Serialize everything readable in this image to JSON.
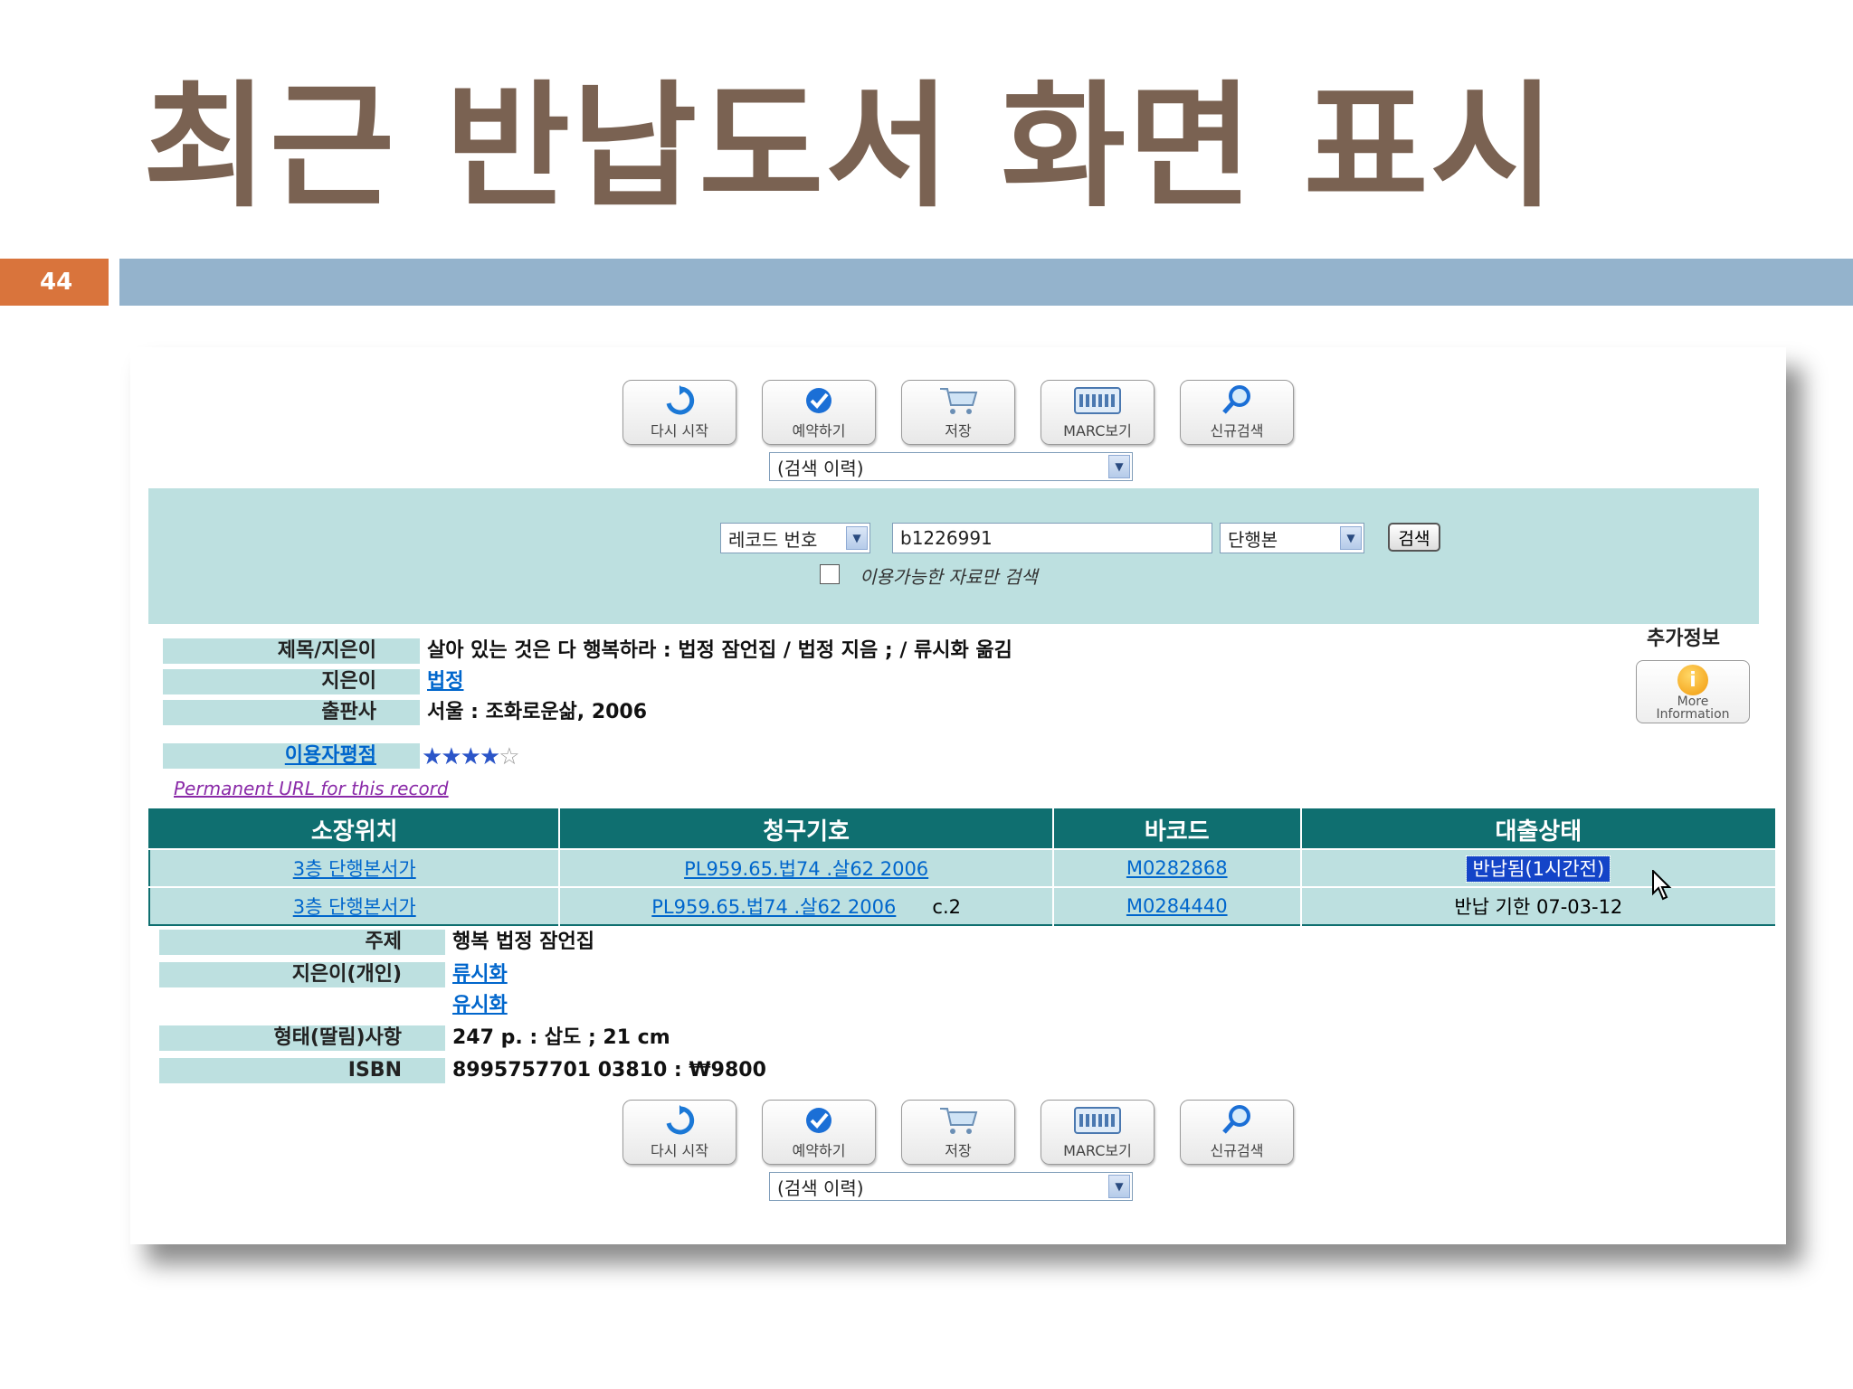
{
  "slide": {
    "title": "최근 반납도서 화면 표시",
    "number": "44"
  },
  "toolbar": {
    "buttons": [
      {
        "label": "다시 시작",
        "icon": "refresh-icon"
      },
      {
        "label": "예약하기",
        "icon": "checkmark-icon"
      },
      {
        "label": "저장",
        "icon": "cart-icon"
      },
      {
        "label": "MARC보기",
        "icon": "marc-grid-icon"
      },
      {
        "label": "신규검색",
        "icon": "magnifier-icon"
      }
    ],
    "history_select": "(검색 이력)"
  },
  "search": {
    "field_select": "레코드 번호",
    "query_value": "b1226991",
    "type_select": "단행본",
    "submit_label": "검색",
    "available_only_label": "이용가능한 자료만 검색"
  },
  "record": {
    "title_label": "제목/지은이",
    "title_value": "살아 있는 것은 다 행복하라 : 법정 잠언집 / 법정 지음 ; / 류시화 옮김",
    "author_label": "지은이",
    "author_value": "법정",
    "publisher_label": "출판사",
    "publisher_value": "서울 : 조화로운삶, 2006",
    "rating_label": "이용자평점",
    "rating_stars": 4,
    "rating_max": 5,
    "permanent_url": "Permanent URL for this record",
    "additional_info": "추가정보",
    "more_info_line1": "More",
    "more_info_line2": "Information"
  },
  "holdings": {
    "headers": [
      "소장위치",
      "청구기호",
      "바코드",
      "대출상태"
    ],
    "rows": [
      {
        "location": "3층 단행본서가",
        "call_number": "PL959.65.법74 .살62 2006",
        "copy": "",
        "barcode": "M0282868",
        "status": "반납됨(1시간전)"
      },
      {
        "location": "3층 단행본서가",
        "call_number": "PL959.65.법74 .살62 2006",
        "copy": "c.2",
        "barcode": "M0284440",
        "status": "반납 기한 07-03-12"
      }
    ]
  },
  "details": {
    "subject_label": "주제",
    "subject_value": "행복 법정 잠언집",
    "personal_author_label": "지은이(개인)",
    "personal_author_1": "류시화",
    "personal_author_2": "유시화",
    "physical_label": "형태(딸림)사항",
    "physical_value": "247 p. : 삽도 ; 21 cm",
    "isbn_label": "ISBN",
    "isbn_value": "8995757701 03810 : ₩9800"
  },
  "colors": {
    "title": "#7a6252",
    "accent_orange": "#d9743c",
    "bar_blue": "#94b3cc",
    "panel": "#bde0e0",
    "table_header": "#0f6f70"
  }
}
